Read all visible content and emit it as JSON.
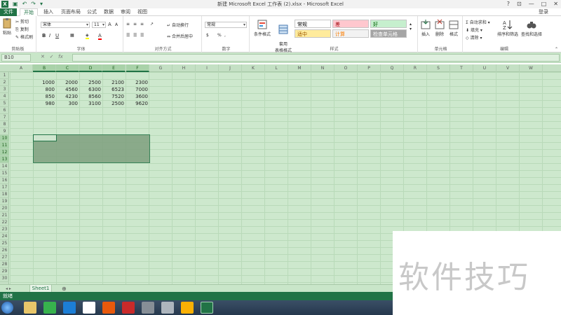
{
  "window": {
    "title": "新建 Microsoft Excel 工作表 (2).xlsx - Microsoft Excel",
    "controls": [
      "?",
      "—",
      "□",
      "✕"
    ],
    "sign_in": "登录"
  },
  "tabs": [
    {
      "label": "文件"
    },
    {
      "label": "开始"
    },
    {
      "label": "插入"
    },
    {
      "label": "页面布局"
    },
    {
      "label": "公式"
    },
    {
      "label": "数据"
    },
    {
      "label": "审阅"
    },
    {
      "label": "视图"
    }
  ],
  "ribbon": {
    "clipboard": {
      "paste": "粘贴",
      "cut": "剪切",
      "copy": "复制",
      "format_painter": "格式刷",
      "label": "剪贴板"
    },
    "font": {
      "name": "宋体",
      "size": "11",
      "label": "字体",
      "bold": "B",
      "italic": "I",
      "underline": "U",
      "grow": "A",
      "shrink": "A"
    },
    "alignment": {
      "wrap": "自动换行",
      "merge": "合并后居中",
      "label": "对齐方式"
    },
    "number": {
      "format": "常规",
      "percent": "%",
      "comma": ",",
      "label": "数字"
    },
    "styles": {
      "conditional": "条件格式",
      "table": "套用\n表格格式",
      "cells": [
        {
          "text": "常规",
          "bg": "#ffffff",
          "color": "#000000"
        },
        {
          "text": "差",
          "bg": "#ffc7ce",
          "color": "#9c0006"
        },
        {
          "text": "好",
          "bg": "#c6efce",
          "color": "#006100"
        },
        {
          "text": "适中",
          "bg": "#ffeb9c",
          "color": "#9c5700"
        },
        {
          "text": "计算",
          "bg": "#f2f2f2",
          "color": "#fa7d00"
        },
        {
          "text": "检查单元格",
          "bg": "#a5a5a5",
          "color": "#ffffff"
        }
      ],
      "label": "样式"
    },
    "cells": {
      "insert": "插入",
      "delete": "删除",
      "format": "格式",
      "label": "单元格"
    },
    "editing": {
      "autosum": "自动求和",
      "fill": "填充",
      "clear": "清除",
      "sort": "排序和筛选",
      "find": "查找和选择",
      "label": "编辑"
    }
  },
  "formula_bar": {
    "name_box": "B10",
    "fx": "fx",
    "value": ""
  },
  "grid": {
    "columns": [
      "A",
      "B",
      "C",
      "D",
      "E",
      "F",
      "G",
      "H",
      "I",
      "J",
      "K",
      "L",
      "M",
      "N",
      "O",
      "P",
      "Q",
      "R",
      "S",
      "T",
      "U",
      "V",
      "W"
    ],
    "rows": [
      "1",
      "2",
      "3",
      "4",
      "5",
      "6",
      "7",
      "8",
      "9",
      "10",
      "11",
      "12",
      "13",
      "14",
      "15",
      "16",
      "17",
      "18",
      "19",
      "20",
      "21",
      "22",
      "23",
      "24",
      "25",
      "26",
      "27",
      "28",
      "29",
      "30"
    ],
    "data": [
      [
        "1000",
        "2000",
        "2500",
        "2100",
        "2300"
      ],
      [
        "800",
        "4560",
        "6300",
        "6523",
        "7000"
      ],
      [
        "850",
        "4230",
        "8560",
        "7520",
        "3600"
      ],
      [
        "980",
        "300",
        "3100",
        "2500",
        "9620"
      ]
    ],
    "selected_range": "B10:F13",
    "active_cell": "B10"
  },
  "sheets": [
    {
      "label": "Sheet1"
    }
  ],
  "add_sheet": "⊕",
  "status": "就绪",
  "watermark": "软件技巧",
  "colors": {
    "excel_green": "#217346",
    "grid_bg": "#cde8cd",
    "header_bg": "#c4e0c4"
  }
}
